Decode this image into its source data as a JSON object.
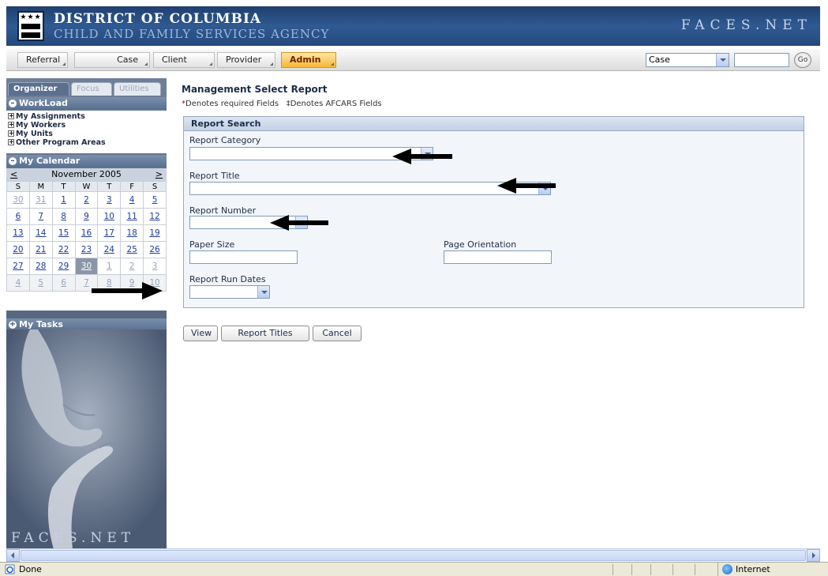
{
  "header": {
    "title_line1": "DISTRICT OF COLUMBIA",
    "title_line2": "CHILD AND FAMILY SERVICES AGENCY",
    "brand": "FACES.NET"
  },
  "menu": {
    "tabs": [
      {
        "label": "Referral"
      },
      {
        "label": "Case"
      },
      {
        "label": "Client"
      },
      {
        "label": "Provider"
      },
      {
        "label": "Admin",
        "active": true
      }
    ],
    "search_select": "Case",
    "search_input": "",
    "go_label": "Go"
  },
  "sidebar": {
    "tabs": [
      "Organizer",
      "Focus",
      "Utilities"
    ],
    "workload": {
      "title": "WorkLoad",
      "items": [
        "My Assignments",
        "My Workers",
        "My Units",
        "Other Program Areas"
      ]
    },
    "calendar": {
      "title": "My Calendar",
      "month": "November 2005",
      "prev": "<",
      "next": ">",
      "weekdays": [
        "S",
        "M",
        "T",
        "W",
        "T",
        "F",
        "S"
      ],
      "weeks": [
        [
          "30",
          "31",
          "1",
          "2",
          "3",
          "4",
          "5"
        ],
        [
          "6",
          "7",
          "8",
          "9",
          "10",
          "11",
          "12"
        ],
        [
          "13",
          "14",
          "15",
          "16",
          "17",
          "18",
          "19"
        ],
        [
          "20",
          "21",
          "22",
          "23",
          "24",
          "25",
          "26"
        ],
        [
          "27",
          "28",
          "29",
          "30",
          "1",
          "2",
          "3"
        ],
        [
          "4",
          "5",
          "6",
          "7",
          "8",
          "9",
          "10"
        ]
      ],
      "today": "30"
    },
    "tasks": {
      "title": "My Tasks"
    },
    "brand": "FACES.NET"
  },
  "main": {
    "title": "Management Select Report",
    "required_marker": "*",
    "required_text": "Denotes required Fields",
    "afcars_marker": "‡",
    "afcars_text": "Denotes AFCARS Fields",
    "panel_title": "Report Search",
    "fields": {
      "report_category": {
        "label": "Report Category",
        "value": ""
      },
      "report_title": {
        "label": "Report Title",
        "value": ""
      },
      "report_number": {
        "label": "Report Number",
        "value": ""
      },
      "paper_size": {
        "label": "Paper Size",
        "value": ""
      },
      "page_orientation": {
        "label": "Page Orientation",
        "value": ""
      },
      "report_run_dates": {
        "label": "Report Run Dates",
        "value": ""
      }
    },
    "buttons": {
      "view": "View",
      "report_titles": "Report Titles",
      "cancel": "Cancel"
    }
  },
  "status": {
    "text": "Done",
    "zone": "Internet"
  }
}
